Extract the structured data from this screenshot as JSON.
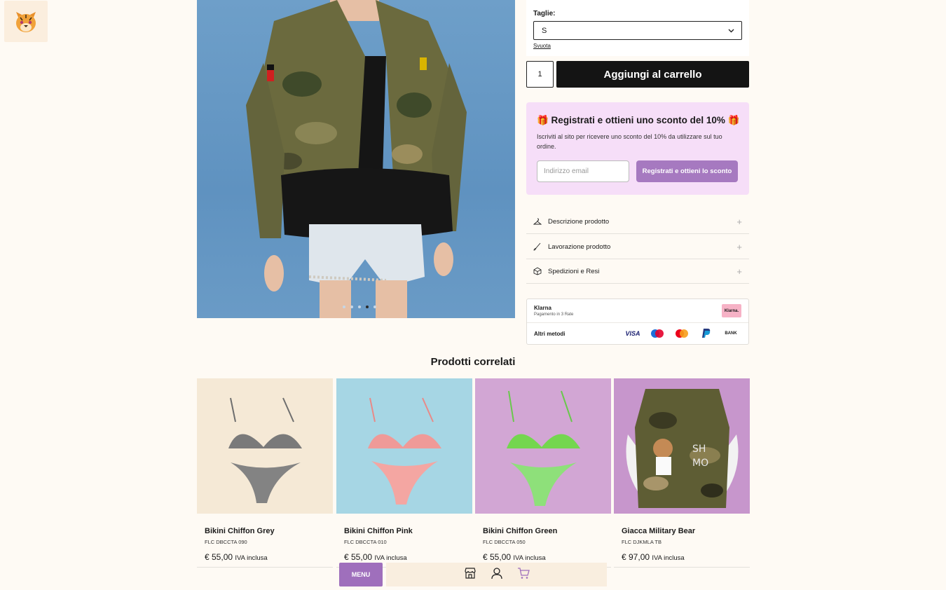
{
  "logo": {
    "icon": "tiger-face-icon"
  },
  "gallery": {
    "slides": 5,
    "active_slide": 4
  },
  "product": {
    "size_label": "Taglie:",
    "size_selected": "S",
    "clear_label": "Svuota",
    "quantity": "1",
    "add_to_cart": "Aggiungi al carrello"
  },
  "promo": {
    "title": "🎁 Registrati e ottieni uno sconto del 10% 🎁",
    "text": "Iscriviti al sito per ricevere uno sconto del 10% da utilizzare sul tuo ordine.",
    "email_placeholder": "Indirizzo email",
    "button": "Registrati e ottieni lo sconto"
  },
  "accordion": [
    {
      "label": "Descrizione prodotto",
      "icon": "hanger-icon"
    },
    {
      "label": "Lavorazione prodotto",
      "icon": "brush-icon"
    },
    {
      "label": "Spedizioni e Resi",
      "icon": "box-icon"
    }
  ],
  "payments": {
    "klarna_title": "Klarna",
    "klarna_sub": "Pagamento in 3 Rate",
    "klarna_badge": "Klarna.",
    "other_title": "Altri metodi",
    "methods": [
      "VISA",
      "Maestro",
      "Mastercard",
      "PayPal",
      "BANK"
    ]
  },
  "related": {
    "title": "Prodotti correlati",
    "items": [
      {
        "name": "Bikini Chiffon Grey",
        "sku": "FLC DBCCTA 090",
        "price": "€ 55,00",
        "vat": "IVA inclusa",
        "bg": "#f5e9d6",
        "color": "#7a7a7a"
      },
      {
        "name": "Bikini Chiffon Pink",
        "sku": "FLC DBCCTA 010",
        "price": "€ 55,00",
        "vat": "IVA inclusa",
        "bg": "#a6d6e4",
        "color": "#ef9a98"
      },
      {
        "name": "Bikini Chiffon Green",
        "sku": "FLC DBCCTA 050",
        "price": "€ 55,00",
        "vat": "IVA inclusa",
        "bg": "#d2a6d4",
        "color": "#7edc5a"
      },
      {
        "name": "Giacca Military Bear",
        "sku": "FLC DJKMLA TB",
        "price": "€ 97,00",
        "vat": "IVA inclusa",
        "bg": "#c796cc",
        "color": "#5e5d34"
      }
    ]
  },
  "bottom_nav": {
    "menu": "MENU",
    "icons": [
      "store-icon",
      "user-icon",
      "cart-icon"
    ]
  },
  "colors": {
    "accent": "#a679c0",
    "background": "#fefaf4",
    "button_dark": "#141414"
  }
}
